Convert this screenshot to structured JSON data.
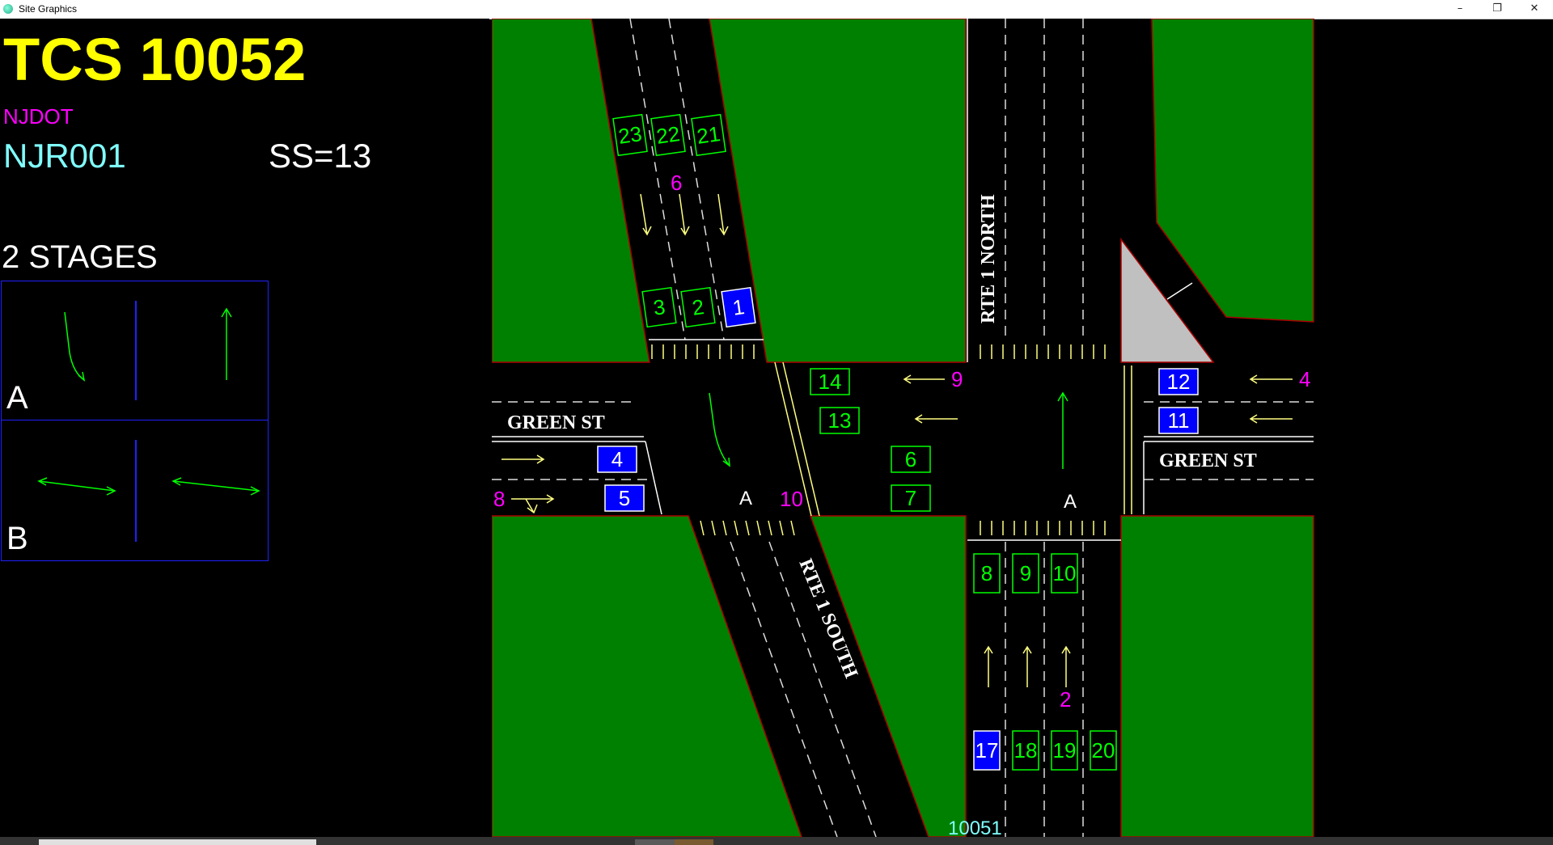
{
  "window": {
    "title": "Site Graphics",
    "minimize_glyph": "–",
    "restore_glyph": "❐",
    "close_glyph": "✕"
  },
  "header": {
    "site_title": "TCS 10052",
    "agency": "NJDOT",
    "site_id": "NJR001",
    "ss": "SS=13"
  },
  "stages": {
    "label": "2 STAGES",
    "items": [
      {
        "letter": "A"
      },
      {
        "letter": "B"
      }
    ]
  },
  "map": {
    "streets": {
      "green_st_west": "GREEN ST",
      "green_st_east": "GREEN ST",
      "rte1_north": "RTE 1 NORTH",
      "rte1_south": "RTE 1 SOUTH"
    },
    "detectors": [
      {
        "id": "23",
        "active": false
      },
      {
        "id": "22",
        "active": false
      },
      {
        "id": "21",
        "active": false
      },
      {
        "id": "3",
        "active": false
      },
      {
        "id": "2",
        "active": false
      },
      {
        "id": "1",
        "active": true
      },
      {
        "id": "14",
        "active": false
      },
      {
        "id": "13",
        "active": false
      },
      {
        "id": "6",
        "active": false
      },
      {
        "id": "7",
        "active": false
      },
      {
        "id": "4",
        "active": true
      },
      {
        "id": "5",
        "active": true
      },
      {
        "id": "12",
        "active": true
      },
      {
        "id": "11",
        "active": true
      },
      {
        "id": "8",
        "active": false
      },
      {
        "id": "9",
        "active": false
      },
      {
        "id": "10",
        "active": false
      },
      {
        "id": "17",
        "active": true
      },
      {
        "id": "18",
        "active": false
      },
      {
        "id": "19",
        "active": false
      },
      {
        "id": "20",
        "active": false
      }
    ],
    "phase_labels": {
      "sb_approach": "6",
      "wb_upper": "9",
      "eb_approach": "4",
      "eb_west": "8",
      "nb_median": "10",
      "nb_approach": "2"
    },
    "stage_markers": {
      "left": "A",
      "right": "A"
    },
    "adjacent_site": "10051",
    "colors": {
      "grass": "#008000",
      "road": "#000000",
      "detector_outline": "#00ff00",
      "detector_active_fill": "#0000ff",
      "arrow_yellow": "#ffff80",
      "phase_magenta": "#ff00ff",
      "island": "#c0c0c0"
    }
  }
}
